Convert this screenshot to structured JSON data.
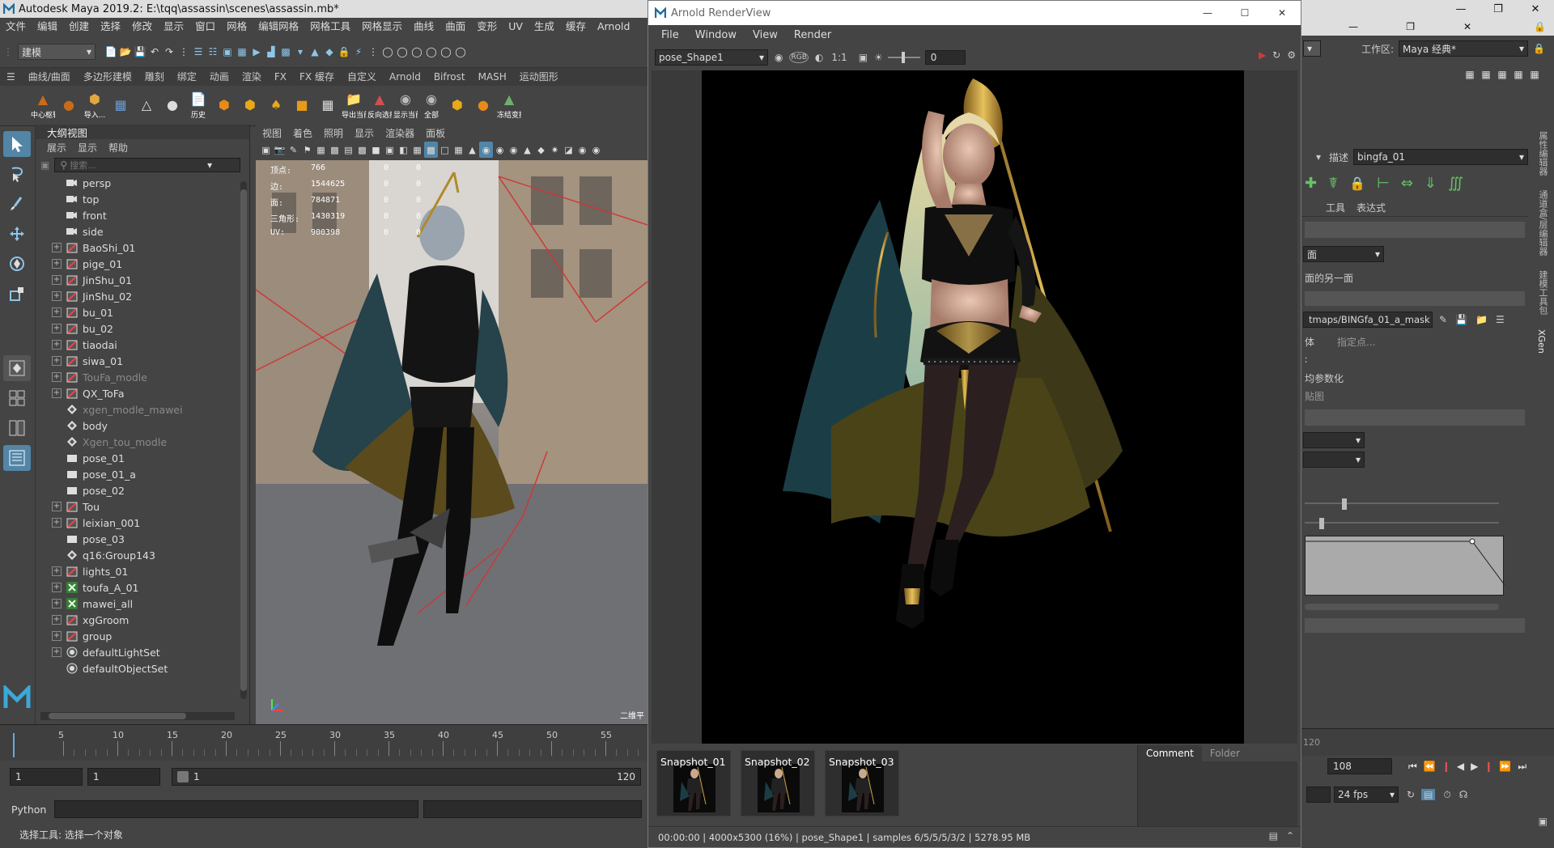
{
  "maya": {
    "title": "Autodesk Maya 2019.2: E:\\tqq\\assassin\\scenes\\assassin.mb*",
    "menus": [
      "文件",
      "编辑",
      "创建",
      "选择",
      "修改",
      "显示",
      "窗口",
      "网格",
      "编辑网格",
      "网格工具",
      "网格显示",
      "曲线",
      "曲面",
      "变形",
      "UV",
      "生成",
      "缓存",
      "Arnold"
    ],
    "mode_dropdown": "建模",
    "shelf_tabs": [
      "曲线/曲面",
      "多边形建模",
      "雕刻",
      "绑定",
      "动画",
      "渲染",
      "FX",
      "FX 缓存",
      "自定义",
      "Arnold",
      "Bifrost",
      "MASH",
      "运动图形"
    ],
    "shelf_labels": [
      "中心枢轴",
      "导入...",
      "历史",
      "导出当前",
      "反向选择",
      "显示当前",
      "全部",
      "冻结变换"
    ],
    "workspace_label": "工作区:",
    "workspace_value": "Maya 经典*",
    "outliner": {
      "title": "大纲视图",
      "menus": [
        "展示",
        "显示",
        "帮助"
      ],
      "search_placeholder": "搜索...",
      "items": [
        {
          "label": "persp",
          "type": "camera",
          "expand": false,
          "dim": false
        },
        {
          "label": "top",
          "type": "camera",
          "expand": false,
          "dim": false
        },
        {
          "label": "front",
          "type": "camera",
          "expand": false,
          "dim": false
        },
        {
          "label": "side",
          "type": "camera",
          "expand": false,
          "dim": false
        },
        {
          "label": "BaoShi_01",
          "type": "mesh",
          "expand": true,
          "dim": false
        },
        {
          "label": "pige_01",
          "type": "mesh",
          "expand": true,
          "dim": false
        },
        {
          "label": "JinShu_01",
          "type": "mesh",
          "expand": true,
          "dim": false
        },
        {
          "label": "JinShu_02",
          "type": "mesh",
          "expand": true,
          "dim": false
        },
        {
          "label": "bu_01",
          "type": "mesh",
          "expand": true,
          "dim": false
        },
        {
          "label": "bu_02",
          "type": "mesh",
          "expand": true,
          "dim": false
        },
        {
          "label": "tiaodai",
          "type": "mesh",
          "expand": true,
          "dim": false
        },
        {
          "label": "siwa_01",
          "type": "mesh",
          "expand": true,
          "dim": false
        },
        {
          "label": "TouFa_modle",
          "type": "mesh",
          "expand": true,
          "dim": true
        },
        {
          "label": "QX_ToFa",
          "type": "mesh",
          "expand": true,
          "dim": false
        },
        {
          "label": "xgen_modle_mawei",
          "type": "group",
          "expand": false,
          "dim": true
        },
        {
          "label": "body",
          "type": "group",
          "expand": false,
          "dim": false
        },
        {
          "label": "Xgen_tou_modle",
          "type": "group",
          "expand": false,
          "dim": true
        },
        {
          "label": "pose_01",
          "type": "box",
          "expand": false,
          "dim": false
        },
        {
          "label": "pose_01_a",
          "type": "box",
          "expand": false,
          "dim": false
        },
        {
          "label": "pose_02",
          "type": "box",
          "expand": false,
          "dim": false
        },
        {
          "label": "Tou",
          "type": "mesh",
          "expand": true,
          "dim": false
        },
        {
          "label": "leixian_001",
          "type": "mesh",
          "expand": true,
          "dim": false
        },
        {
          "label": "pose_03",
          "type": "box",
          "expand": false,
          "dim": false
        },
        {
          "label": "q16:Group143",
          "type": "group",
          "expand": false,
          "dim": false
        },
        {
          "label": "lights_01",
          "type": "mesh",
          "expand": true,
          "dim": false
        },
        {
          "label": "toufa_A_01",
          "type": "xgen",
          "expand": true,
          "dim": false
        },
        {
          "label": "mawei_all",
          "type": "xgen",
          "expand": true,
          "dim": false
        },
        {
          "label": "xgGroom",
          "type": "mesh",
          "expand": true,
          "dim": false
        },
        {
          "label": "group",
          "type": "mesh",
          "expand": true,
          "dim": false
        },
        {
          "label": "defaultLightSet",
          "type": "set",
          "expand": true,
          "dim": false
        },
        {
          "label": "defaultObjectSet",
          "type": "set",
          "expand": false,
          "dim": false
        }
      ]
    },
    "viewport": {
      "menus": [
        "视图",
        "着色",
        "照明",
        "显示",
        "渲染器",
        "面板"
      ],
      "hud": [
        {
          "k": "顶点:",
          "v": "766",
          "z": "0",
          "z2": "0"
        },
        {
          "k": "边:",
          "v": "1544625",
          "z": "0",
          "z2": "0"
        },
        {
          "k": "面:",
          "v": "784871",
          "z": "0",
          "z2": "0"
        },
        {
          "k": "三角形:",
          "v": "1430319",
          "z": "0",
          "z2": "0"
        },
        {
          "k": "UV:",
          "v": "900398",
          "z": "0",
          "z2": "0"
        }
      ],
      "corner_label": "二维平"
    },
    "timeline_ticks": [
      "5",
      "10",
      "15",
      "20",
      "25",
      "30",
      "35",
      "40",
      "45",
      "50",
      "55"
    ],
    "range": {
      "start": "1",
      "start2": "1",
      "slider": "1",
      "end": "120"
    },
    "cmd_label": "Python",
    "help_text": "选择工具: 选择一个对象",
    "right": {
      "describe_label": "描述",
      "describe_value": "bingfa_01",
      "tabs": [
        "工具",
        "表达式"
      ],
      "dropdown1": "面",
      "text1": "面的另一面",
      "map_path": "tmaps/BINGfa_01_a_mask",
      "text2": "体",
      "text3": "指定点...",
      "text4": "均参数化",
      "text5": "贴图",
      "frame_field": "108",
      "frame_120": "120",
      "fps": "24 fps",
      "side_tabs": [
        "属性编辑器",
        "通道盒/层编辑器",
        "建模工具包",
        "XGen"
      ]
    }
  },
  "arnold": {
    "title": "Arnold RenderView",
    "menus": [
      "File",
      "Window",
      "View",
      "Render"
    ],
    "camera": "pose_Shape1",
    "ratio": "1:1",
    "exposure": "0",
    "snapshots": [
      "Snapshot_01",
      "Snapshot_02",
      "Snapshot_03"
    ],
    "comment_tabs": [
      "Comment",
      "Folder"
    ],
    "status": "00:00:00 | 4000x5300 (16%) | pose_Shape1  | samples 6/5/5/5/3/2 | 5278.95 MB"
  },
  "colors": {
    "accent": "#5285a6",
    "maya_bg": "#444444",
    "dark_field": "#2b2b2b",
    "render_bg": "#000000",
    "stop_red": "#c83c3c"
  }
}
